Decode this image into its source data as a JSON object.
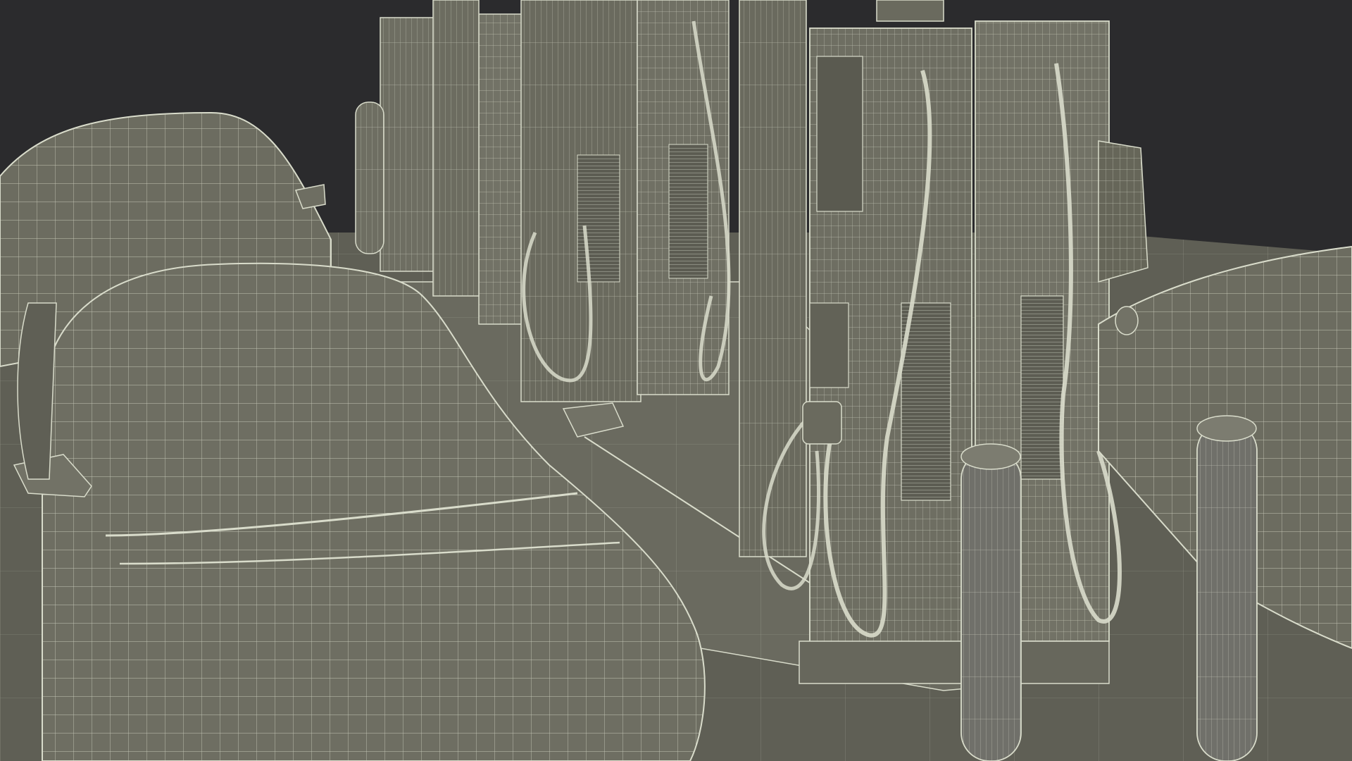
{
  "scene": {
    "subject": "ev-charging-station-wireframe",
    "colors": {
      "background": "#2b2b2d",
      "surface": "#6e6e62",
      "surface_dark": "#5c5c52",
      "surface_light": "#7e7e72",
      "wire": "#d9dccb",
      "shadow": "#4a4a42"
    },
    "objects": [
      "car-front-left",
      "car-rear-left",
      "car-right",
      "charger-pair-front",
      "charger-pair-back",
      "canopy-columns",
      "bollards",
      "concrete-island",
      "ground-plane"
    ]
  }
}
